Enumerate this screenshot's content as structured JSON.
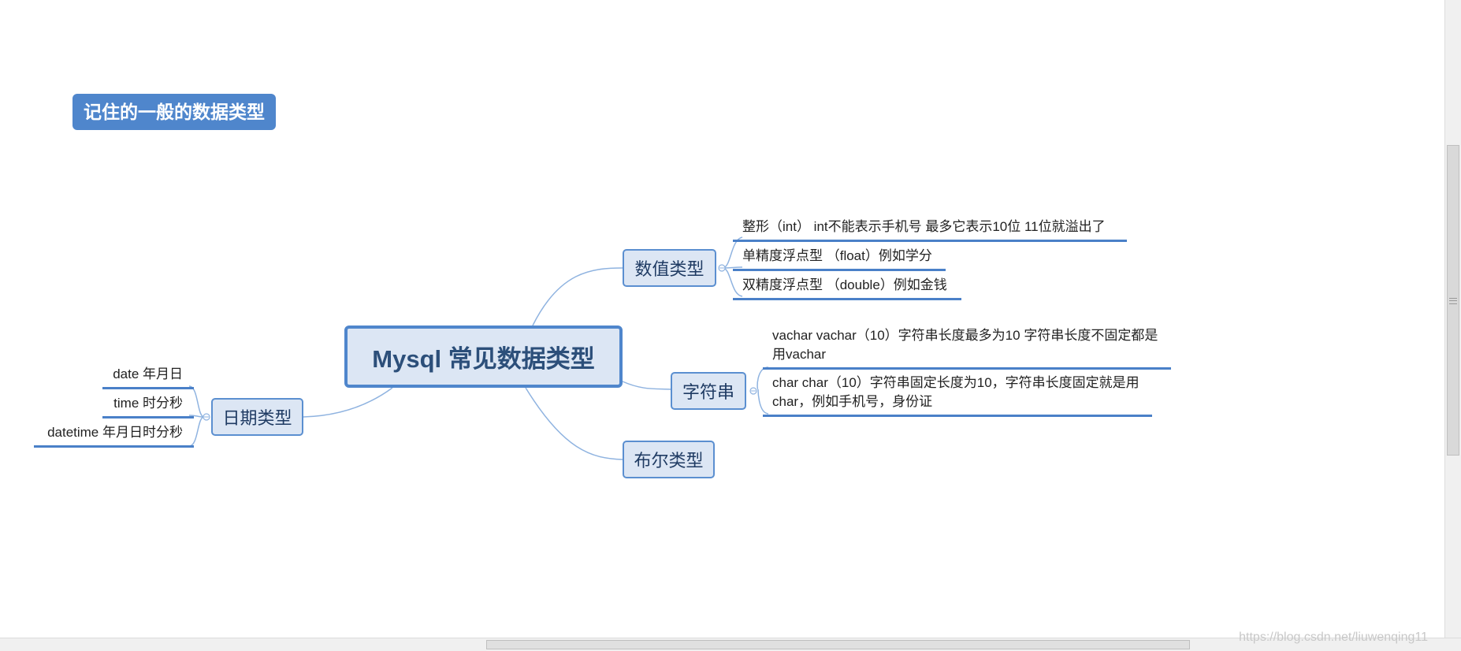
{
  "badge": "记住的一般的数据类型",
  "root": "Mysql 常见数据类型",
  "branches": {
    "numeric": {
      "label": "数值类型",
      "items": [
        "整形（int）  int不能表示手机号 最多它表示10位 11位就溢出了",
        "单精度浮点型 （float）例如学分",
        "双精度浮点型 （double）例如金钱"
      ]
    },
    "string": {
      "label": "字符串",
      "items": [
        [
          "vachar vachar（10）字符串长度最多为10 字符串长度不固定都是",
          "用vachar"
        ],
        [
          "char char（10）字符串固定长度为10，字符串长度固定就是用",
          "char，例如手机号，身份证"
        ]
      ]
    },
    "boolean": {
      "label": "布尔类型"
    },
    "date": {
      "label": "日期类型",
      "items": [
        "date 年月日",
        "time 时分秒",
        "datetime 年月日时分秒"
      ]
    }
  },
  "watermark": "https://blog.csdn.net/liuwenqing11",
  "colors": {
    "line": "#8fb3e0",
    "accent": "#4f86cc",
    "node_fill": "#dce6f4"
  }
}
